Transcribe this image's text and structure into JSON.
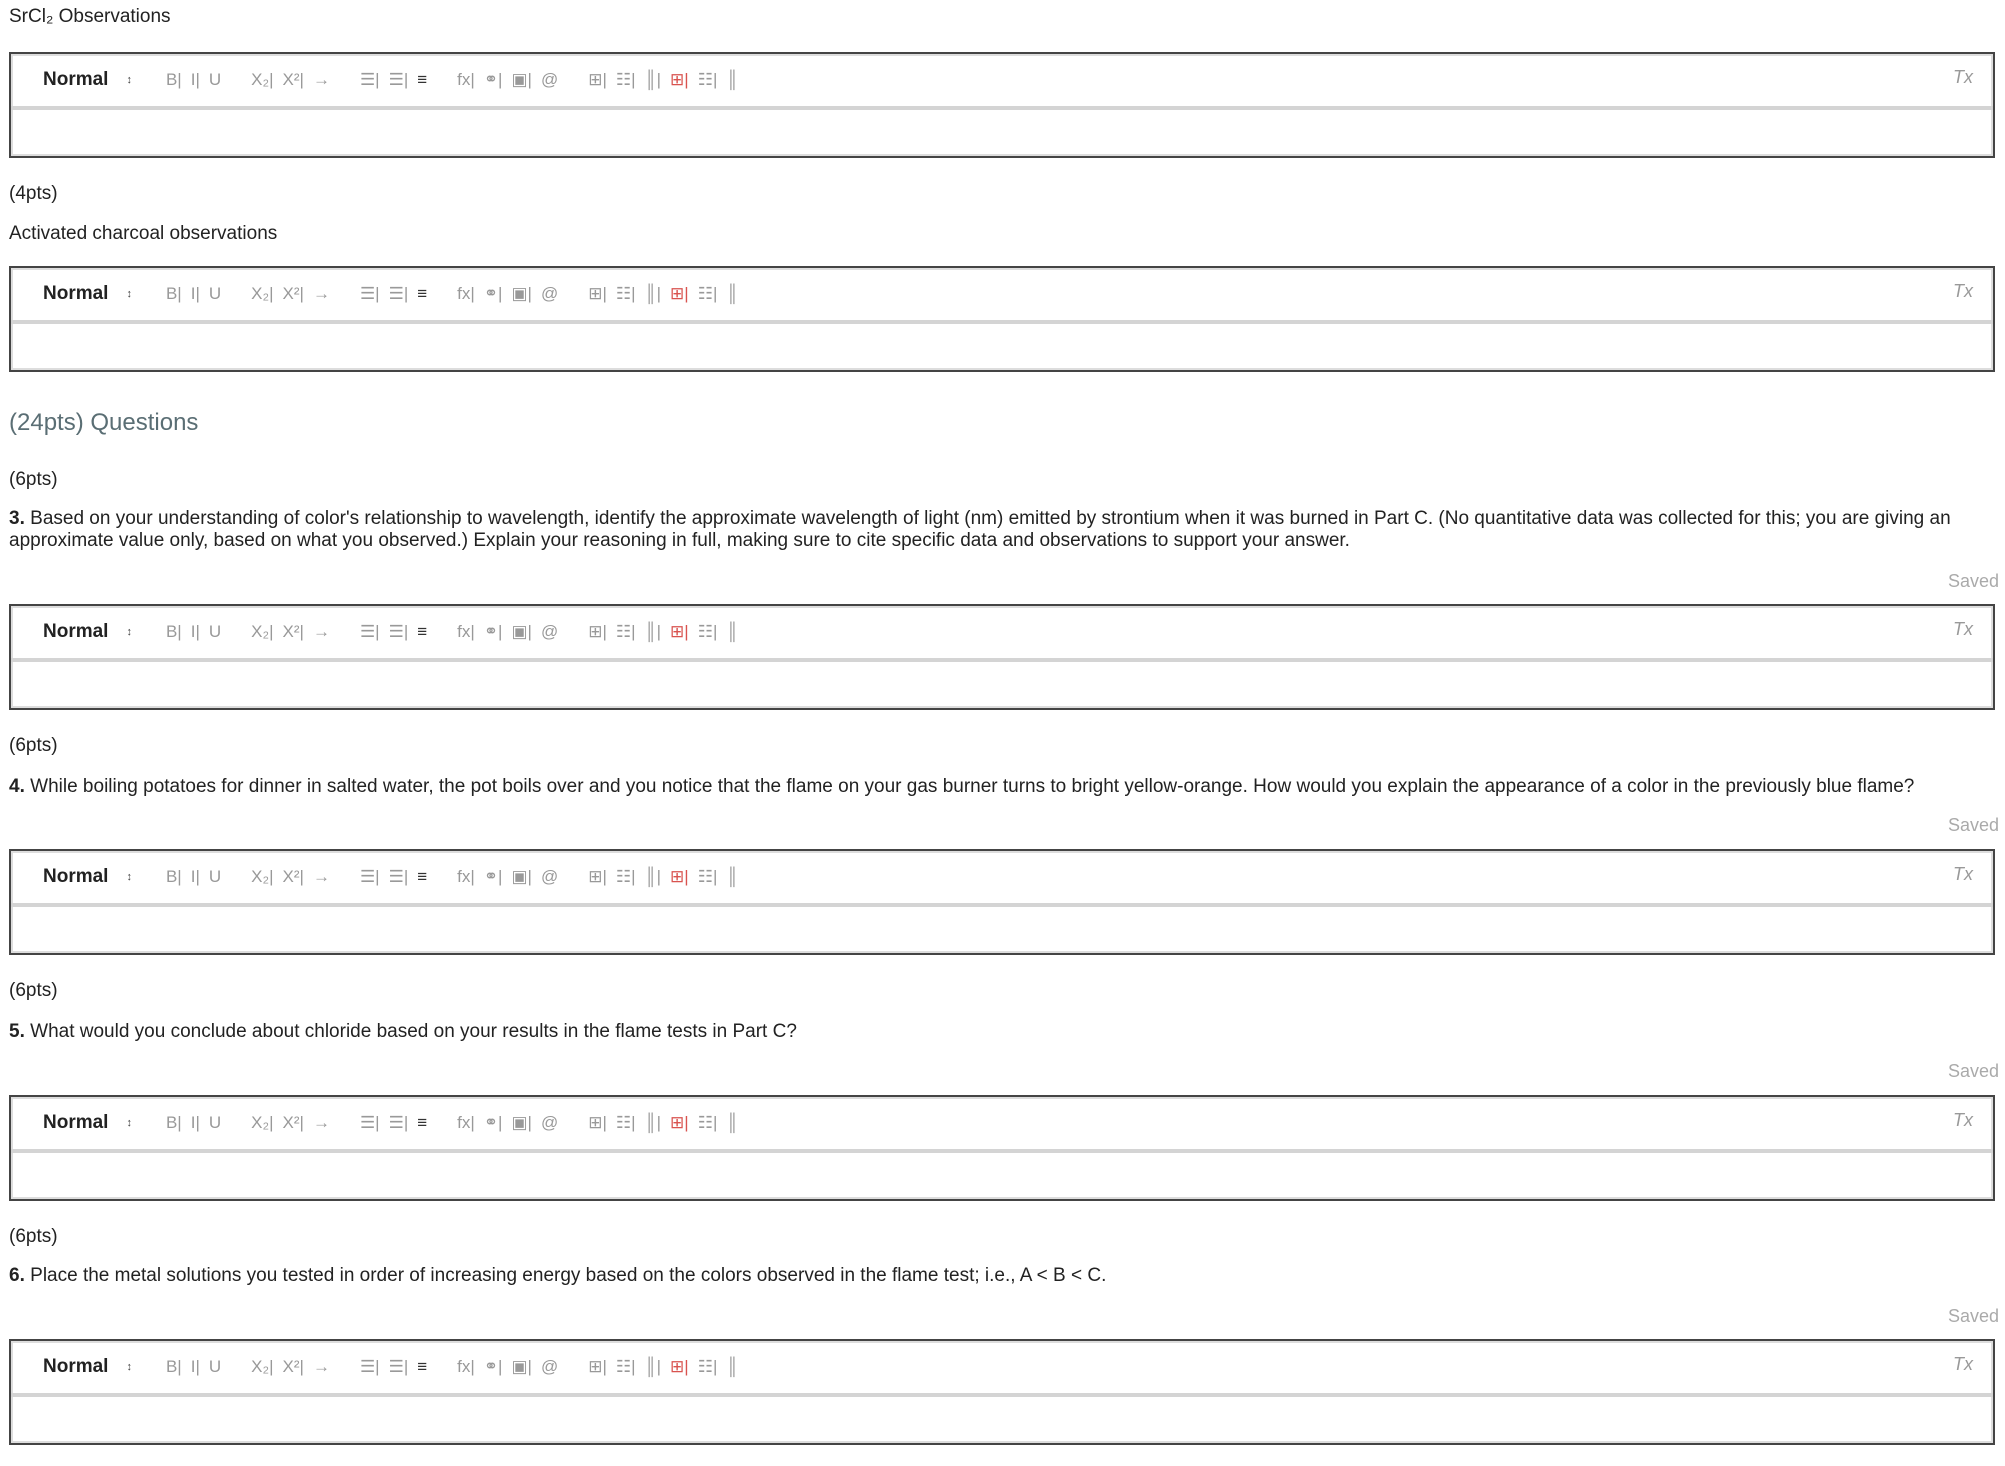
{
  "sections": [
    {
      "label": "SrCl₂ Observations"
    },
    {
      "points": "(4pts)",
      "label": "Activated charcoal observations"
    }
  ],
  "questions_heading": "(24pts) Questions",
  "questions": [
    {
      "points": "(6pts)",
      "number": "3.",
      "text": "Based on your understanding of color's relationship to wavelength, identify the approximate wavelength of light (nm) emitted by strontium when it was burned in Part C. (No quantitative data was collected for this; you are giving an approximate value only, based on what you observed.) Explain your reasoning in full, making sure to cite specific data and observations to support your answer.",
      "status": "Saved"
    },
    {
      "points": "(6pts)",
      "number": "4.",
      "text": "While boiling potatoes for dinner in salted water, the pot boils over and you notice that the flame on your gas burner turns to bright yellow-orange. How would you explain the appearance of a color in the previously blue flame?",
      "status": "Saved"
    },
    {
      "points": "(6pts)",
      "number": "5.",
      "text": "What would you conclude about chloride based on your results in the flame tests in Part C?",
      "status": "Saved"
    },
    {
      "points": "(6pts)",
      "number": "6.",
      "text": "Place the metal solutions you tested in order of increasing energy based on the colors observed in the flame test; i.e., A < B < C.",
      "status": "Saved"
    }
  ],
  "editor": {
    "format_value": "Normal",
    "format_arrow": "↕",
    "clear_format": "Tx",
    "buttons": [
      {
        "name": "bold",
        "glyph": "B|"
      },
      {
        "name": "italic",
        "glyph": "I|"
      },
      {
        "name": "underline",
        "glyph": "U",
        "gap": true
      },
      {
        "name": "subscript",
        "glyph": "X₂|"
      },
      {
        "name": "superscript",
        "glyph": "X²|"
      },
      {
        "name": "indent",
        "glyph": "→",
        "gap": true
      },
      {
        "name": "ordered-list",
        "glyph": "☰|"
      },
      {
        "name": "bullet-list",
        "glyph": "☰|"
      },
      {
        "name": "align",
        "glyph": "≡",
        "gap": true,
        "dark": true
      },
      {
        "name": "formula",
        "glyph": "fx|"
      },
      {
        "name": "link",
        "glyph": "⚭|"
      },
      {
        "name": "image",
        "glyph": "▣|"
      },
      {
        "name": "attachment",
        "glyph": "@",
        "gap": true
      },
      {
        "name": "table",
        "glyph": "⊞|"
      },
      {
        "name": "insert-row",
        "glyph": "☷|"
      },
      {
        "name": "insert-column",
        "glyph": "║|"
      },
      {
        "name": "delete-table",
        "glyph": "⊞|",
        "red": true
      },
      {
        "name": "delete-row",
        "glyph": "☷|"
      },
      {
        "name": "delete-column",
        "glyph": "║"
      }
    ]
  }
}
